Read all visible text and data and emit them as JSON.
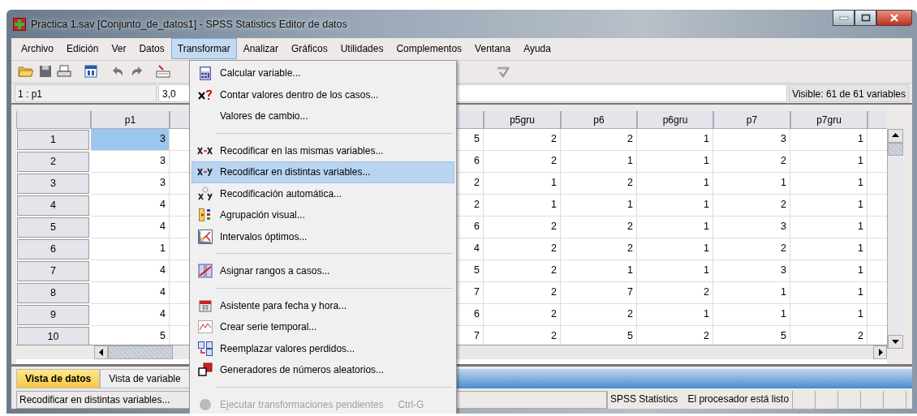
{
  "window": {
    "title": "Practica 1.sav [Conjunto_de_datos1] - SPSS Statistics Editor de datos"
  },
  "menu_bar": [
    {
      "label": "Archivo",
      "selected": false
    },
    {
      "label": "Edición",
      "selected": false
    },
    {
      "label": "Ver",
      "selected": false
    },
    {
      "label": "Datos",
      "selected": false
    },
    {
      "label": "Transformar",
      "selected": true
    },
    {
      "label": "Analizar",
      "selected": false
    },
    {
      "label": "Gráficos",
      "selected": false
    },
    {
      "label": "Utilidades",
      "selected": false
    },
    {
      "label": "Complementos",
      "selected": false
    },
    {
      "label": "Ventana",
      "selected": false
    },
    {
      "label": "Ayuda",
      "selected": false
    }
  ],
  "cell_bar": {
    "cell_ref": "1 : p1",
    "cell_value": "3,0",
    "visible_info": "Visible: 61 de 61 variables"
  },
  "table": {
    "columns": [
      "p1",
      "p5gru",
      "p6",
      "p6gru",
      "p7",
      "p7gru"
    ],
    "rows": [
      {
        "case": "1",
        "selected": true,
        "cells": [
          "3",
          "5",
          "2",
          "2",
          "1",
          "3",
          "1"
        ]
      },
      {
        "case": "2",
        "selected": false,
        "cells": [
          "3",
          "6",
          "2",
          "1",
          "1",
          "2",
          "1"
        ]
      },
      {
        "case": "3",
        "selected": false,
        "cells": [
          "3",
          "2",
          "1",
          "2",
          "1",
          "1",
          "1"
        ]
      },
      {
        "case": "4",
        "selected": false,
        "cells": [
          "4",
          "2",
          "1",
          "1",
          "1",
          "2",
          "1"
        ]
      },
      {
        "case": "5",
        "selected": false,
        "cells": [
          "4",
          "6",
          "2",
          "2",
          "1",
          "3",
          "1"
        ]
      },
      {
        "case": "6",
        "selected": false,
        "cells": [
          "1",
          "4",
          "2",
          "2",
          "1",
          "2",
          "1"
        ]
      },
      {
        "case": "7",
        "selected": false,
        "cells": [
          "4",
          "5",
          "2",
          "1",
          "1",
          "3",
          "1"
        ]
      },
      {
        "case": "8",
        "selected": false,
        "cells": [
          "4",
          "7",
          "2",
          "7",
          "2",
          "1",
          "1"
        ]
      },
      {
        "case": "9",
        "selected": false,
        "cells": [
          "4",
          "6",
          "2",
          "2",
          "1",
          "1",
          "1"
        ]
      },
      {
        "case": "10",
        "selected": false,
        "cells": [
          "5",
          "7",
          "2",
          "5",
          "2",
          "5",
          "2"
        ]
      }
    ]
  },
  "view_tabs": [
    {
      "label": "Vista de datos",
      "selected": true
    },
    {
      "label": "Vista de variable",
      "selected": false
    }
  ],
  "status_bar": {
    "message": "Recodificar en distintas variables...",
    "app": "SPSS Statistics",
    "state": "El procesador está listo"
  },
  "dropdown_menu": {
    "items": [
      {
        "kind": "item",
        "label": "Calcular variable...",
        "selected": false,
        "disabled": false
      },
      {
        "kind": "item",
        "label": "Contar valores dentro de los casos...",
        "selected": false,
        "disabled": false
      },
      {
        "kind": "item",
        "label": "Valores de cambio...",
        "selected": false,
        "disabled": false
      },
      {
        "kind": "separator"
      },
      {
        "kind": "item",
        "label": "Recodificar en las mismas variables...",
        "selected": false,
        "disabled": false
      },
      {
        "kind": "item",
        "label": "Recodificar en distintas variables...",
        "selected": true,
        "disabled": false
      },
      {
        "kind": "item",
        "label": "Recodificación automática...",
        "selected": false,
        "disabled": false
      },
      {
        "kind": "item",
        "label": "Agrupación visual...",
        "selected": false,
        "disabled": false
      },
      {
        "kind": "item",
        "label": "Intervalos óptimos...",
        "selected": false,
        "disabled": false
      },
      {
        "kind": "separator"
      },
      {
        "kind": "item",
        "label": "Asignar rangos a casos...",
        "selected": false,
        "disabled": false
      },
      {
        "kind": "separator"
      },
      {
        "kind": "item",
        "label": "Asistente para fecha y hora...",
        "selected": false,
        "disabled": false
      },
      {
        "kind": "item",
        "label": "Crear serie temporal...",
        "selected": false,
        "disabled": false
      },
      {
        "kind": "item",
        "label": "Reemplazar valores perdidos...",
        "selected": false,
        "disabled": false
      },
      {
        "kind": "item",
        "label": "Generadores de números aleatorios...",
        "selected": false,
        "disabled": false
      },
      {
        "kind": "separator"
      },
      {
        "kind": "item",
        "label": "Ejecutar transformaciones pendientes",
        "shortcut": "Ctrl-G",
        "selected": false,
        "disabled": true
      }
    ]
  }
}
